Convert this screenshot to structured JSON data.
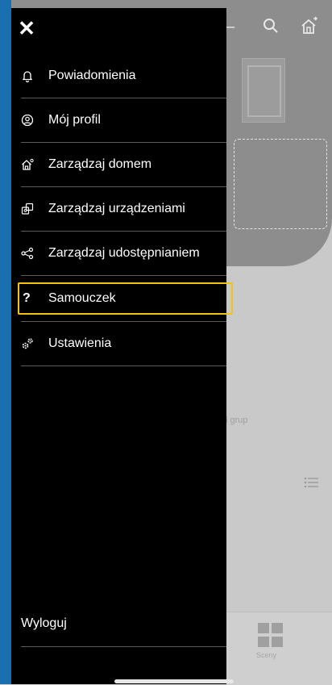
{
  "drawer": {
    "close_label": "✕",
    "items": [
      {
        "label": "Powiadomienia",
        "icon": "bell-icon"
      },
      {
        "label": "Mój profil",
        "icon": "profile-icon"
      },
      {
        "label": "Zarządzaj domem",
        "icon": "home-gear-icon"
      },
      {
        "label": "Zarządzaj urządzeniami",
        "icon": "devices-icon"
      },
      {
        "label": "Zarządzaj udostępnianiem",
        "icon": "share-icon"
      },
      {
        "label": "Samouczek",
        "icon": "question-icon",
        "selected": true
      },
      {
        "label": "Ustawienia",
        "icon": "settings-icon"
      }
    ],
    "logout_label": "Wyloguj"
  },
  "background": {
    "grup_text": "i grup",
    "bottom_tab_label": "Sceny"
  },
  "colors": {
    "drawer_bg": "#000000",
    "focus_outline": "#f2c40f",
    "frame_blue": "#1a6fb0"
  }
}
